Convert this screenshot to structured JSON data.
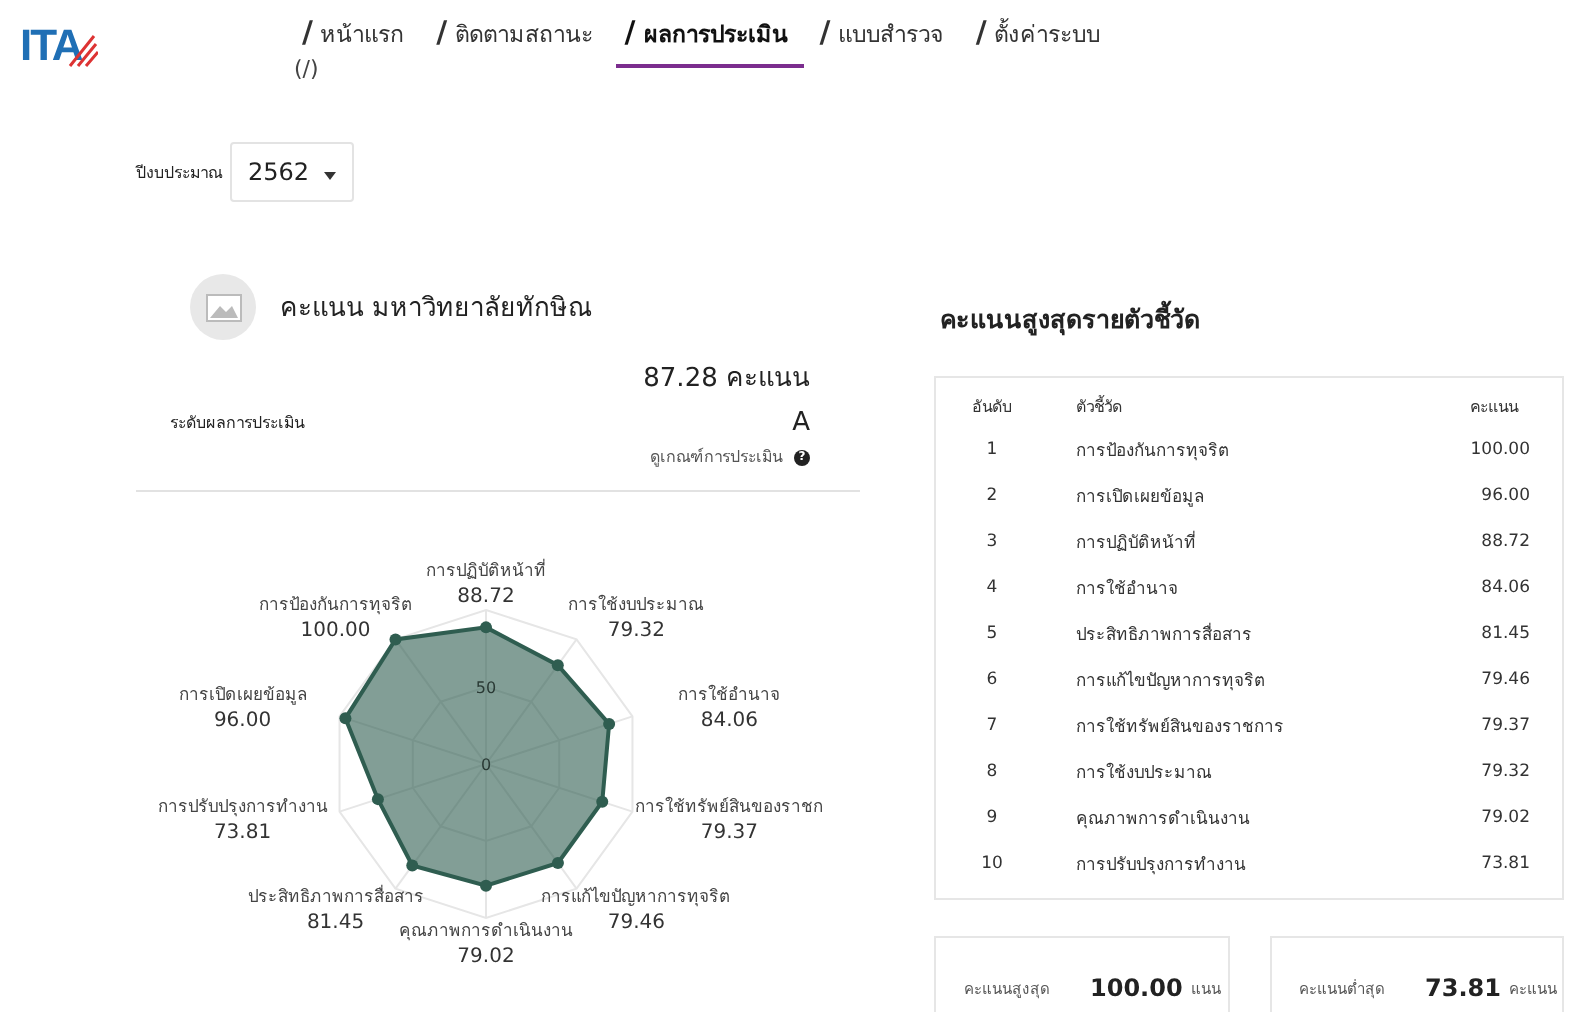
{
  "logo": {
    "text": "ITA"
  },
  "nav": [
    {
      "mark": "/",
      "label": "หน้าแรก",
      "selected": false
    },
    {
      "mark": "/",
      "label": "ติดตามสถานะ",
      "selected": false
    },
    {
      "mark": "/",
      "label": "ผลการประเมิน",
      "selected": true
    },
    {
      "mark": "/",
      "label": "แบบสำรวจ",
      "selected": false
    },
    {
      "mark": "/",
      "label": "ตั้งค่าระบบ",
      "selected": false
    }
  ],
  "nav_extra": "(/)",
  "year_filter": {
    "label": "ปีงบประมาณ",
    "value": "2562"
  },
  "score_card": {
    "title": "คะแนน มหาวิทยาลัยทักษิณ",
    "score": "87.28 คะแนน",
    "grade_label": "ระดับผลการประเมิน",
    "grade": "A",
    "criteria_link": "ดูเกณฑ์การประเมิน",
    "help_icon": "?"
  },
  "radar": {
    "ticks": [
      "50",
      "0"
    ],
    "axes": [
      {
        "label": "การปฏิบัติหน้าที่",
        "value": "88.72"
      },
      {
        "label": "การป้องกันการทุจริต",
        "value": "100.00"
      },
      {
        "label": "การใช้งบประมาณ",
        "value": "79.32"
      },
      {
        "label": "การเปิดเผยข้อมูล",
        "value": "96.00"
      },
      {
        "label": "การใช้อำนาจ",
        "value": "84.06"
      },
      {
        "label": "การปรับปรุงการทำงาน",
        "value": "73.81"
      },
      {
        "label": "การใช้ทรัพย์สินของราชก",
        "value": "79.37"
      },
      {
        "label": "ประสิทธิภาพการสื่อสาร",
        "value": "81.45"
      },
      {
        "label": "การแก้ไขปัญหาการทุจริต",
        "value": "79.46"
      },
      {
        "label": "คุณภาพการดำเนินงาน",
        "value": "79.02"
      }
    ]
  },
  "ranking": {
    "title": "คะแนนสูงสุดรายตัวชี้วัด",
    "columns": [
      "อันดับ",
      "ตัวชี้วัด",
      "คะแนน"
    ],
    "rows": [
      [
        "1",
        "การป้องกันการทุจริต",
        "100.00"
      ],
      [
        "2",
        "การเปิดเผยข้อมูล",
        "96.00"
      ],
      [
        "3",
        "การปฏิบัติหน้าที่",
        "88.72"
      ],
      [
        "4",
        "การใช้อำนาจ",
        "84.06"
      ],
      [
        "5",
        "ประสิทธิภาพการสื่อสาร",
        "81.45"
      ],
      [
        "6",
        "การแก้ไขปัญหาการทุจริต",
        "79.46"
      ],
      [
        "7",
        "การใช้ทรัพย์สินของราชการ",
        "79.37"
      ],
      [
        "8",
        "การใช้งบประมาณ",
        "79.32"
      ],
      [
        "9",
        "คุณภาพการดำเนินงาน",
        "79.02"
      ],
      [
        "10",
        "การปรับปรุงการทำงาน",
        "73.81"
      ]
    ]
  },
  "summary": [
    {
      "label": "คะแนนสูงสุด",
      "value": "100.00",
      "unit": "แนน"
    },
    {
      "label": "คะแนนต่ำสุด",
      "value": "73.81",
      "unit": "คะแนน"
    }
  ]
}
